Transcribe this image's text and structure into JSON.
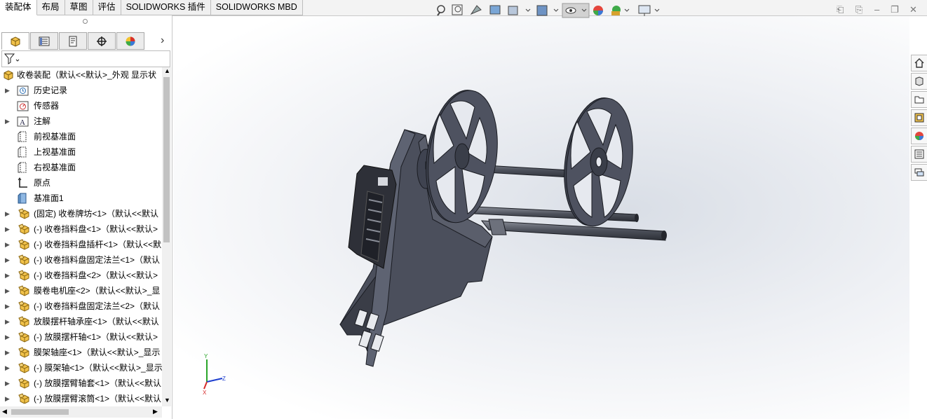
{
  "tabs": [
    "装配体",
    "布局",
    "草图",
    "评估",
    "SOLIDWORKS 插件",
    "SOLIDWORKS MBD"
  ],
  "active_tab": 0,
  "panel": {
    "tab_icons": [
      "feature-manager-icon",
      "property-manager-icon",
      "configuration-manager-icon",
      "dimxpert-icon",
      "display-manager-icon"
    ],
    "expand_chevron": "›",
    "filter_icon": "filter-icon"
  },
  "tree": {
    "root": "收卷装配（默认<<默认>_外观 显示状",
    "items": [
      {
        "label": "历史记录",
        "icon": "history-icon",
        "expand": true
      },
      {
        "label": "传感器",
        "icon": "sensor-icon",
        "expand": false
      },
      {
        "label": "注解",
        "icon": "annotation-icon",
        "expand": true
      },
      {
        "label": "前视基准面",
        "icon": "plane-icon",
        "expand": false
      },
      {
        "label": "上视基准面",
        "icon": "plane-icon",
        "expand": false
      },
      {
        "label": "右视基准面",
        "icon": "plane-icon",
        "expand": false
      },
      {
        "label": "原点",
        "icon": "origin-icon",
        "expand": false
      },
      {
        "label": "基准面1",
        "icon": "plane-solid-icon",
        "expand": false
      },
      {
        "label": "(固定) 收卷牌坊<1>（默认<<默认",
        "icon": "part-icon",
        "expand": true
      },
      {
        "label": "(-) 收卷挡料盘<1>（默认<<默认>",
        "icon": "part-icon",
        "expand": true
      },
      {
        "label": "(-) 收卷挡料盘插杆<1>（默认<<默",
        "icon": "part-icon",
        "expand": true
      },
      {
        "label": "(-) 收卷挡料盘固定法兰<1>（默认",
        "icon": "part-icon",
        "expand": true
      },
      {
        "label": "(-) 收卷挡料盘<2>（默认<<默认>",
        "icon": "part-icon",
        "expand": true
      },
      {
        "label": "膜卷电机座<2>（默认<<默认>_显",
        "icon": "part-icon",
        "expand": true
      },
      {
        "label": "(-) 收卷挡料盘固定法兰<2>（默认",
        "icon": "part-icon",
        "expand": true
      },
      {
        "label": "放膜摆杆轴承座<1>（默认<<默认",
        "icon": "part-icon",
        "expand": true
      },
      {
        "label": "(-) 放膜摆杆轴<1>（默认<<默认>",
        "icon": "part-icon",
        "expand": true
      },
      {
        "label": "膜架轴座<1>（默认<<默认>_显示",
        "icon": "part-icon",
        "expand": true
      },
      {
        "label": "(-) 膜架轴<1>（默认<<默认>_显示",
        "icon": "part-icon",
        "expand": true
      },
      {
        "label": "(-) 放膜摆臂轴套<1>（默认<<默认",
        "icon": "part-icon",
        "expand": true
      },
      {
        "label": "(-) 放膜摆臂滚筒<1>（默认<<默认",
        "icon": "part-icon",
        "expand": true
      }
    ]
  },
  "view_toolbar": [
    "zoom-to-fit-icon",
    "zoom-to-area-icon",
    "previous-view-icon",
    "section-view-icon",
    "view-orientation-icon",
    "display-style-icon",
    "hide-show-items-icon",
    "edit-appearance-icon",
    "apply-scene-icon",
    "view-settings-icon"
  ],
  "task_pane": [
    "home-icon",
    "design-library-icon",
    "file-explorer-icon",
    "view-palette-icon",
    "appearances-icon",
    "custom-properties-icon",
    "forum-icon"
  ],
  "triad": {
    "x": "X",
    "y": "Y",
    "z": "Z"
  },
  "colors": {
    "part": "#4e5260",
    "part_edge": "#1a1c22",
    "accent": "#1e6fc8"
  }
}
